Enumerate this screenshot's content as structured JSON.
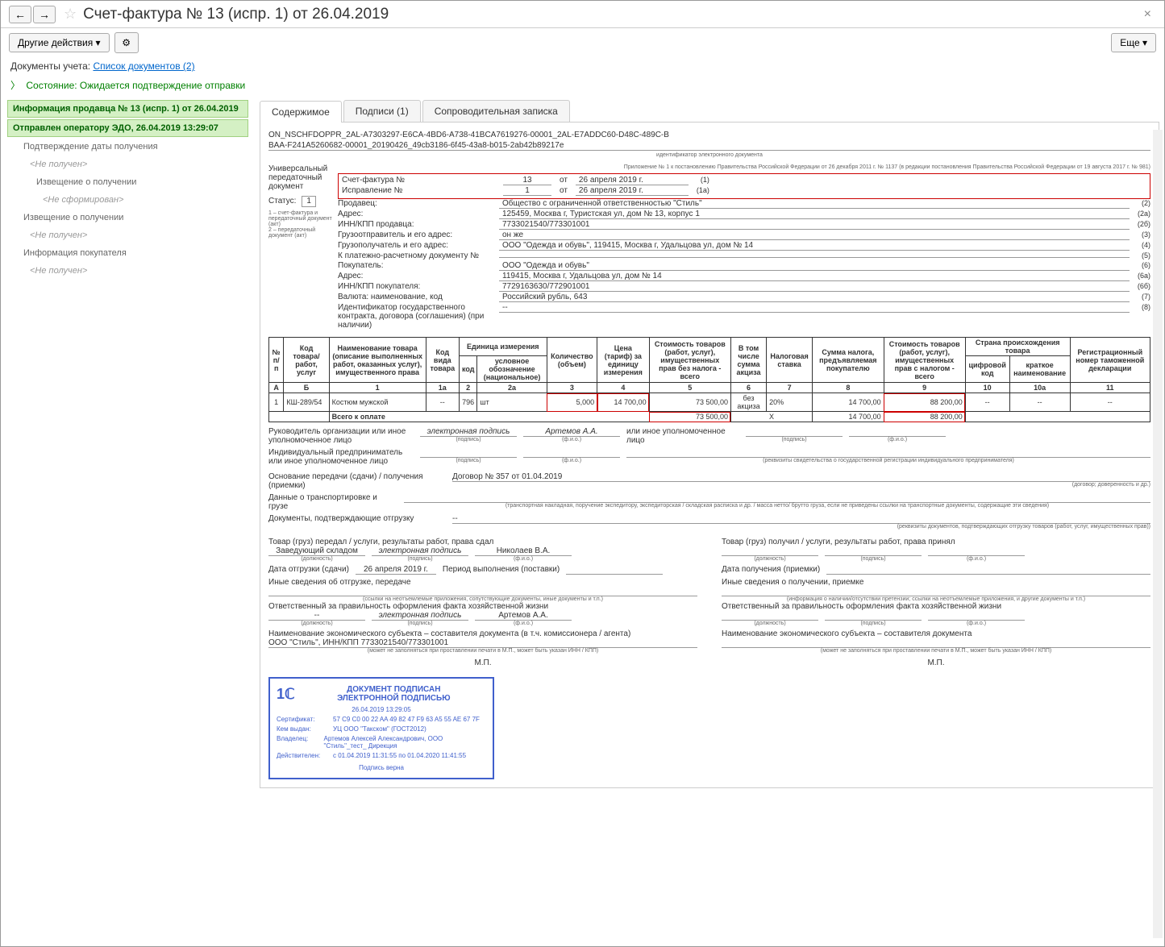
{
  "title": "Счет-фактура № 13 (испр. 1) от 26.04.2019",
  "toolbar": {
    "other_actions": "Другие действия",
    "more": "Еще"
  },
  "doc_links": {
    "label": "Документы учета:",
    "link": "Список документов (2)"
  },
  "status_line": "Состояние: Ожидается подтверждение отправки",
  "sidebar": {
    "item1": "Информация продавца № 13 (испр. 1) от 26.04.2019",
    "item2": "Отправлен оператору ЭДО, 26.04.2019 13:29:07",
    "item3": "Подтверждение даты получения",
    "not_received": "<Не получен>",
    "item4": "Извещение о получении",
    "not_formed": "<Не сформирован>",
    "item5": "Извещение о получении",
    "item6": "Информация покупателя"
  },
  "tabs": {
    "content": "Содержимое",
    "signatures": "Подписи (1)",
    "note": "Сопроводительная записка"
  },
  "doc": {
    "id1": "ON_NSCHFDOPPR_2AL-A7303297-E6CA-4BD6-A738-41BCA7619276-00001_2AL-E7ADDC60-D48C-489C-B",
    "id2": "BAA-F241A5260682-00001_20190426_49cb3186-6f45-43a8-b015-2ab42b89217e",
    "id_note": "идентификатор электронного документа",
    "appendix": "Приложение № 1 к постановлению Правительства Российской Федерации от 26 декабря 2011 г. № 1137 (в редакции постановления Правительства Российской Федерации от 19 августа 2017 г. № 981)",
    "upd_label": "Универсальный передаточный документ",
    "status_label": "Статус:",
    "status_val": "1",
    "status_note1": "1 – счет-фактура и передаточный документ (акт)",
    "status_note2": "2 – передаточный документ (акт)",
    "sf_label": "Счет-фактура №",
    "sf_num": "13",
    "from": "от",
    "sf_date": "26 апреля 2019 г.",
    "n1": "(1)",
    "corr_label": "Исправление №",
    "corr_num": "1",
    "corr_date": "26 апреля 2019 г.",
    "n1a": "(1а)",
    "rows": [
      {
        "label": "Продавец:",
        "val": "Общество с ограниченной ответственностью \"Стиль\"",
        "n": "(2)"
      },
      {
        "label": "Адрес:",
        "val": "125459, Москва г, Туристская ул, дом № 13, корпус 1",
        "n": "(2а)"
      },
      {
        "label": "ИНН/КПП продавца:",
        "val": "7733021540/773301001",
        "n": "(2б)"
      },
      {
        "label": "Грузоотправитель и его адрес:",
        "val": "он же",
        "n": "(3)"
      },
      {
        "label": "Грузополучатель и его адрес:",
        "val": "ООО \"Одежда и обувь\", 119415, Москва г, Удальцова ул, дом № 14",
        "n": "(4)"
      },
      {
        "label": "К платежно-расчетному документу №",
        "val": "",
        "n": "(5)"
      },
      {
        "label": "Покупатель:",
        "val": "ООО \"Одежда и обувь\"",
        "n": "(6)"
      },
      {
        "label": "Адрес:",
        "val": "119415, Москва г, Удальцова ул, дом № 14",
        "n": "(6а)"
      },
      {
        "label": "ИНН/КПП покупателя:",
        "val": "7729163630/772901001",
        "n": "(6б)"
      },
      {
        "label": "Валюта: наименование, код",
        "val": "Российский рубль, 643",
        "n": "(7)"
      },
      {
        "label": "Идентификатор государственного контракта, договора (соглашения) (при наличии)",
        "val": "--",
        "n": "(8)"
      }
    ],
    "table_headers": {
      "h_np": "№ п/п",
      "h_code": "Код товара/ работ, услуг",
      "h_name": "Наименование товара (описание выполненных работ, оказанных услуг), имущественного права",
      "h_kind": "Код вида товара",
      "h_unit": "Единица измерения",
      "h_unit_code": "код",
      "h_unit_name": "условное обозначение (национальное)",
      "h_qty": "Количество (объем)",
      "h_price": "Цена (тариф) за единицу измерения",
      "h_cost_notax": "Стоимость товаров (работ, услуг), имущественных прав без налога - всего",
      "h_excise": "В том числе сумма акциза",
      "h_rate": "Налоговая ставка",
      "h_tax": "Сумма налога, предъявляемая покупателю",
      "h_cost_tax": "Стоимость товаров (работ, услуг), имущественных прав с налогом - всего",
      "h_country": "Страна происхождения товара",
      "h_country_code": "цифровой код",
      "h_country_name": "краткое наименование",
      "h_decl": "Регистрационный номер таможенной декларации",
      "r2": [
        "А",
        "Б",
        "1",
        "1а",
        "2",
        "2а",
        "3",
        "4",
        "5",
        "6",
        "7",
        "8",
        "9",
        "10",
        "10а",
        "11"
      ]
    },
    "table_data": {
      "np": "1",
      "code": "КШ-289/54",
      "name": "Костюм мужской",
      "kind": "--",
      "unit_code": "796",
      "unit_name": "шт",
      "qty": "5,000",
      "price": "14 700,00",
      "cost_notax": "73 500,00",
      "excise": "без акциза",
      "rate": "20%",
      "tax": "14 700,00",
      "cost_tax": "88 200,00",
      "cc": "--",
      "cn": "--",
      "decl": "--"
    },
    "total_label": "Всего к оплате",
    "total_notax": "73 500,00",
    "total_x": "Х",
    "total_tax": "14 700,00",
    "total_wtax": "88 200,00",
    "sig": {
      "head": "Руководитель организации или иное уполномоченное лицо",
      "esig": "электронная подпись",
      "head_name": "Артемов А.А.",
      "sub_sign": "(подпись)",
      "sub_fio": "(ф.и.о.)",
      "other": "или иное уполномоченное лицо",
      "ip": "Индивидуальный предприниматель или иное уполномоченное лицо",
      "ip_note": "(реквизиты свидетельства о государственной регистрации индивидуального предпринимателя)"
    },
    "basis_label": "Основание передачи (сдачи) / получения (приемки)",
    "basis_val": "Договор № 357 от 01.04.2019",
    "basis_note": "(договор; доверенность и др.)",
    "transport_label": "Данные о транспортировке и грузе",
    "transport_note": "(транспортная накладная, поручение экспедитору, экспедиторская / складская расписка и др. / масса нетто/ брутто груза, если не приведены ссылки на транспортные документы, содержащие эти сведения)",
    "shipdocs_label": "Документы, подтверждающие отгрузку",
    "shipdocs_val": "--",
    "shipdocs_note": "(реквизиты документов, подтверждающих отгрузку товаров (работ, услуг, имущественных прав))",
    "left": {
      "title": "Товар (груз) передал / услуги, результаты работ, права сдал",
      "pos": "Заведующий складом",
      "name": "Николаев В.А.",
      "pos_note": "(должность)",
      "date_label": "Дата отгрузки (сдачи)",
      "date": "26 апреля 2019 г.",
      "period": "Период выполнения (поставки)",
      "other_label": "Иные сведения об отгрузке, передаче",
      "other_note": "(ссылки на неотъемлемые приложения, сопутствующие документы, иные документы и т.п.)",
      "resp_label": "Ответственный за правильность оформления факта хозяйственной жизни",
      "resp_pos": "--",
      "resp_name": "Артемов А.А.",
      "econ_label": "Наименование экономического субъекта – составителя документа (в т.ч. комиссионера / агента)",
      "econ_val": "ООО \"Стиль\", ИНН/КПП 7733021540/773301001",
      "econ_note": "(может не заполняться при проставлении печати в М.П., может быть указан ИНН / КПП)",
      "mp": "М.П."
    },
    "right": {
      "title": "Товар (груз) получил / услуги, результаты работ, права принял",
      "date_label": "Дата получения (приемки)",
      "other_label": "Иные сведения о получении, приемке",
      "other_note": "(информация о наличии/отсутствии претензии; ссылки на неотъемлемые приложения, и другие документы и т.п.)",
      "resp_label": "Ответственный за правильность оформления факта хозяйственной жизни",
      "econ_label": "Наименование экономического субъекта – составителя документа",
      "econ_note": "(может не заполняться при проставлении печати в М.П., может быть указан ИНН / КПП)",
      "mp": "М.П."
    },
    "stamp": {
      "title1": "ДОКУМЕНТ ПОДПИСАН",
      "title2": "ЭЛЕКТРОННОЙ ПОДПИСЬЮ",
      "time": "26.04.2019 13:29:05",
      "cert_l": "Сертификат:",
      "cert": "57 C9 C0 00 22 AA 49 82 47 F9 63 A5 55 AE 67 7F",
      "issuer_l": "Кем выдан:",
      "issuer": "УЦ ООО \"Такском\" (ГОСТ2012)",
      "owner_l": "Владелец:",
      "owner": "Артемов Алексей Александрович, ООО \"Стиль\"_тест_ Дирекция",
      "valid_l": "Действителен:",
      "valid": "с 01.04.2019 11:31:55 по 01.04.2020 11:41:55",
      "footer": "Подпись верна"
    }
  }
}
